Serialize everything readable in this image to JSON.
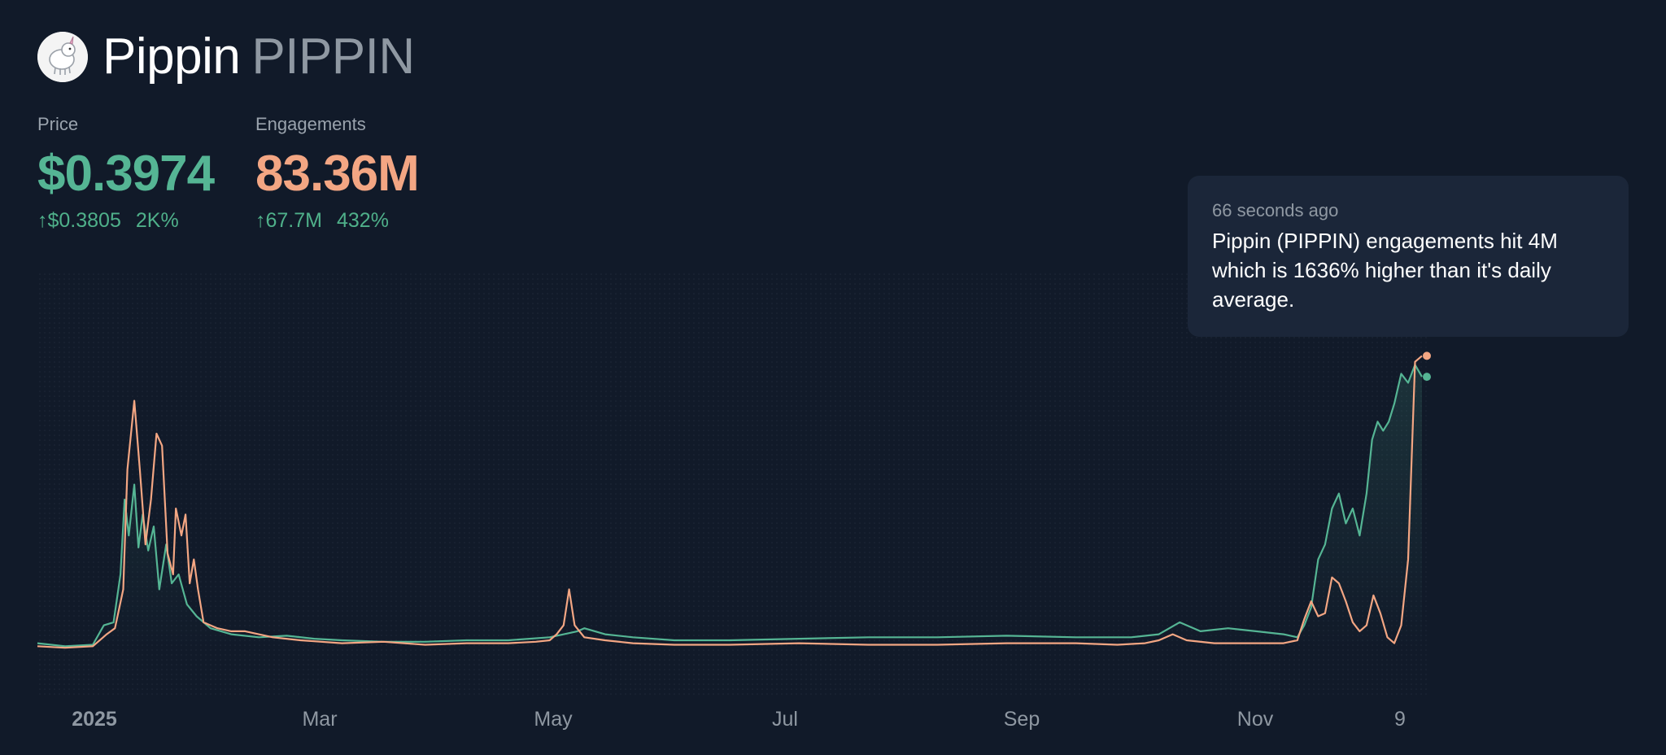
{
  "token": {
    "name": "Pippin",
    "symbol": "PIPPIN"
  },
  "price": {
    "label": "Price",
    "value": "$0.3974",
    "change_abs": "↑$0.3805",
    "change_pct": "2K%"
  },
  "engagements": {
    "label": "Engagements",
    "value": "83.36M",
    "change_abs": "↑67.7M",
    "change_pct": "432%"
  },
  "alert": {
    "time": "66 seconds ago",
    "message": "Pippin (PIPPIN) engagements hit 4M which is 1636% higher than it's daily average."
  },
  "colors": {
    "price": "#55b594",
    "engagements": "#f3a683",
    "background": "#111a29",
    "axis_text": "#8f98a2"
  },
  "chart_data": {
    "type": "line",
    "x_ticks": [
      "2025",
      "Mar",
      "May",
      "Jul",
      "Sep",
      "Nov",
      "9"
    ],
    "ylim": [
      0,
      1
    ],
    "grid": false,
    "legend": "none",
    "series": [
      {
        "key": "price",
        "points": [
          [
            0.0,
            0.02
          ],
          [
            0.02,
            0.01
          ],
          [
            0.04,
            0.015
          ],
          [
            0.048,
            0.08
          ],
          [
            0.055,
            0.09
          ],
          [
            0.06,
            0.25
          ],
          [
            0.063,
            0.5
          ],
          [
            0.066,
            0.38
          ],
          [
            0.07,
            0.55
          ],
          [
            0.073,
            0.34
          ],
          [
            0.076,
            0.45
          ],
          [
            0.08,
            0.33
          ],
          [
            0.084,
            0.41
          ],
          [
            0.088,
            0.2
          ],
          [
            0.093,
            0.35
          ],
          [
            0.097,
            0.22
          ],
          [
            0.102,
            0.25
          ],
          [
            0.108,
            0.15
          ],
          [
            0.115,
            0.11
          ],
          [
            0.125,
            0.07
          ],
          [
            0.14,
            0.05
          ],
          [
            0.16,
            0.04
          ],
          [
            0.18,
            0.045
          ],
          [
            0.2,
            0.035
          ],
          [
            0.22,
            0.03
          ],
          [
            0.25,
            0.025
          ],
          [
            0.28,
            0.025
          ],
          [
            0.31,
            0.03
          ],
          [
            0.34,
            0.03
          ],
          [
            0.37,
            0.04
          ],
          [
            0.385,
            0.055
          ],
          [
            0.39,
            0.06
          ],
          [
            0.395,
            0.07
          ],
          [
            0.41,
            0.05
          ],
          [
            0.43,
            0.04
          ],
          [
            0.46,
            0.03
          ],
          [
            0.5,
            0.03
          ],
          [
            0.55,
            0.035
          ],
          [
            0.6,
            0.04
          ],
          [
            0.65,
            0.04
          ],
          [
            0.7,
            0.045
          ],
          [
            0.75,
            0.04
          ],
          [
            0.79,
            0.04
          ],
          [
            0.81,
            0.05
          ],
          [
            0.825,
            0.09
          ],
          [
            0.84,
            0.06
          ],
          [
            0.86,
            0.07
          ],
          [
            0.88,
            0.06
          ],
          [
            0.9,
            0.05
          ],
          [
            0.91,
            0.04
          ],
          [
            0.915,
            0.08
          ],
          [
            0.92,
            0.14
          ],
          [
            0.925,
            0.3
          ],
          [
            0.93,
            0.35
          ],
          [
            0.935,
            0.47
          ],
          [
            0.94,
            0.52
          ],
          [
            0.945,
            0.42
          ],
          [
            0.95,
            0.47
          ],
          [
            0.955,
            0.38
          ],
          [
            0.96,
            0.52
          ],
          [
            0.964,
            0.7
          ],
          [
            0.968,
            0.76
          ],
          [
            0.972,
            0.73
          ],
          [
            0.976,
            0.76
          ],
          [
            0.98,
            0.82
          ],
          [
            0.985,
            0.92
          ],
          [
            0.99,
            0.89
          ],
          [
            0.995,
            0.95
          ],
          [
            1.0,
            0.91
          ]
        ]
      },
      {
        "key": "engagements",
        "points": [
          [
            0.0,
            0.01
          ],
          [
            0.02,
            0.005
          ],
          [
            0.04,
            0.01
          ],
          [
            0.05,
            0.05
          ],
          [
            0.056,
            0.07
          ],
          [
            0.062,
            0.2
          ],
          [
            0.065,
            0.6
          ],
          [
            0.07,
            0.83
          ],
          [
            0.074,
            0.6
          ],
          [
            0.078,
            0.35
          ],
          [
            0.082,
            0.5
          ],
          [
            0.086,
            0.72
          ],
          [
            0.09,
            0.68
          ],
          [
            0.094,
            0.32
          ],
          [
            0.098,
            0.25
          ],
          [
            0.1,
            0.47
          ],
          [
            0.104,
            0.38
          ],
          [
            0.107,
            0.45
          ],
          [
            0.11,
            0.22
          ],
          [
            0.113,
            0.3
          ],
          [
            0.116,
            0.2
          ],
          [
            0.12,
            0.09
          ],
          [
            0.13,
            0.07
          ],
          [
            0.14,
            0.06
          ],
          [
            0.15,
            0.06
          ],
          [
            0.17,
            0.04
          ],
          [
            0.19,
            0.03
          ],
          [
            0.22,
            0.02
          ],
          [
            0.25,
            0.025
          ],
          [
            0.28,
            0.015
          ],
          [
            0.31,
            0.02
          ],
          [
            0.34,
            0.02
          ],
          [
            0.36,
            0.025
          ],
          [
            0.37,
            0.03
          ],
          [
            0.375,
            0.05
          ],
          [
            0.38,
            0.08
          ],
          [
            0.384,
            0.2
          ],
          [
            0.388,
            0.08
          ],
          [
            0.395,
            0.04
          ],
          [
            0.41,
            0.03
          ],
          [
            0.43,
            0.02
          ],
          [
            0.46,
            0.015
          ],
          [
            0.5,
            0.015
          ],
          [
            0.55,
            0.02
          ],
          [
            0.6,
            0.015
          ],
          [
            0.65,
            0.015
          ],
          [
            0.7,
            0.02
          ],
          [
            0.75,
            0.02
          ],
          [
            0.78,
            0.015
          ],
          [
            0.8,
            0.02
          ],
          [
            0.81,
            0.03
          ],
          [
            0.82,
            0.05
          ],
          [
            0.83,
            0.03
          ],
          [
            0.85,
            0.02
          ],
          [
            0.88,
            0.02
          ],
          [
            0.9,
            0.02
          ],
          [
            0.91,
            0.03
          ],
          [
            0.915,
            0.1
          ],
          [
            0.92,
            0.16
          ],
          [
            0.925,
            0.11
          ],
          [
            0.93,
            0.12
          ],
          [
            0.935,
            0.24
          ],
          [
            0.94,
            0.22
          ],
          [
            0.945,
            0.16
          ],
          [
            0.95,
            0.09
          ],
          [
            0.955,
            0.06
          ],
          [
            0.96,
            0.08
          ],
          [
            0.965,
            0.18
          ],
          [
            0.97,
            0.12
          ],
          [
            0.975,
            0.04
          ],
          [
            0.98,
            0.02
          ],
          [
            0.985,
            0.08
          ],
          [
            0.99,
            0.3
          ],
          [
            0.995,
            0.96
          ],
          [
            1.0,
            0.98
          ]
        ]
      }
    ]
  }
}
